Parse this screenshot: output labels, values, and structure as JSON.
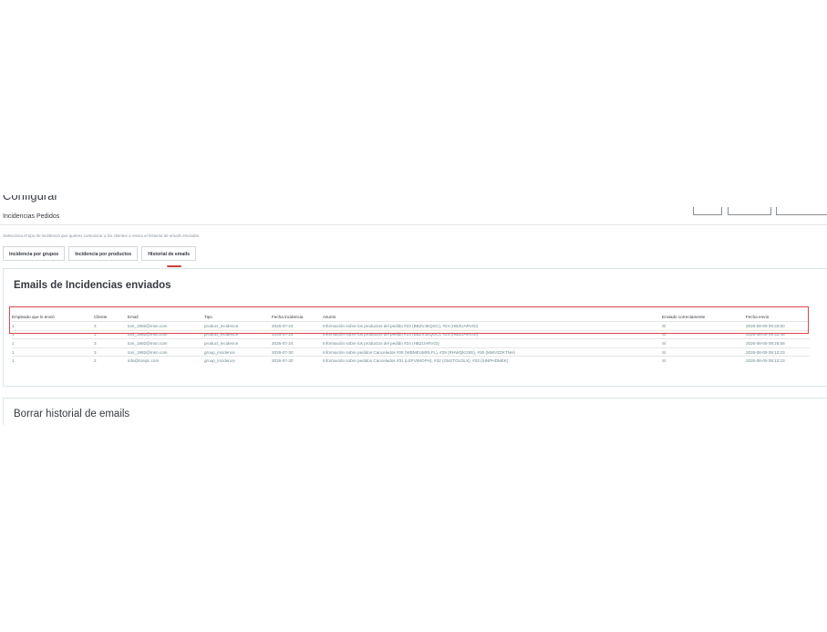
{
  "header": {
    "title": "Configurar",
    "subtitle": "Incidencias Pedidos"
  },
  "help_text": "Selecciona el tipo de incidencia que quieres comunicar a los clientes o revisa el historial de emails enviados.",
  "tabs": [
    {
      "label": "Incidencia por grupos",
      "active": false
    },
    {
      "label": "Incidencia por productos",
      "active": false
    },
    {
      "label": "Historial de emails",
      "active": true
    }
  ],
  "emails_panel": {
    "title": "Emails de Incidencias enviados",
    "columns": [
      "Empleado que lo envió",
      "Cliente",
      "Email",
      "Tipo",
      "Fecha incidencia",
      "Asunto",
      "Enviado correctamente",
      "Fecha envío"
    ],
    "rows": [
      [
        "1",
        "3",
        "toni_1982@msn.com",
        "product_incidence",
        "2026-07-24",
        "Información sobre los productos del pedido #23 (BBZVJEQGC), #24 (HBZUARVGI)",
        "Sí",
        "2026-08-09 09:33:50"
      ],
      [
        "1",
        "3",
        "toni_1982@msn.com",
        "product_incidence",
        "2026-07-24",
        "Información sobre los productos del pedido #23 (BBZVJEQGC), #24 (HBZUARVGI)",
        "Sí",
        "2026-08-09 09:32:49"
      ],
      [
        "1",
        "3",
        "toni_1982@msn.com",
        "product_incidence",
        "2026-07-24",
        "Información sobre los productos del pedido #24 (HBZUARVGI)",
        "Sí",
        "2026-08-09 09:26:58"
      ],
      [
        "1",
        "3",
        "toni_1982@msn.com",
        "group_incidence",
        "2026-07-30",
        "Información sobre pedidos Cancelados #28 (WBMEUMRLFL), #29 (RHWQKGIIE), #30 (MWVZZKTNH)",
        "Sí",
        "2026-08-09 09:12:23"
      ],
      [
        "1",
        "2",
        "info@tonipc.com",
        "group_incidence",
        "2026-07-30",
        "Información sobre pedidos Cancelados #31 (LEFVIMOPH), #32 (GMJTOLDLX), #33 (SINPHDMEK)",
        "Sí",
        "2026-08-09 09:12:23"
      ]
    ]
  },
  "delete_panel": {
    "title": "Borrar historial de emails"
  },
  "colors": {
    "active_tab_underline": "#c9413a",
    "highlight_box": "#e2454f",
    "card_border": "#dbe6e9"
  }
}
